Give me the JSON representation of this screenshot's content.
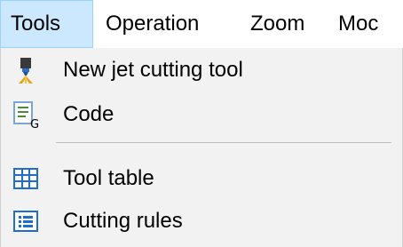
{
  "menubar": {
    "items": [
      {
        "label": "Tools",
        "active": true
      },
      {
        "label": "Operation",
        "active": false
      },
      {
        "label": "Zoom",
        "active": false
      },
      {
        "label": "Moc",
        "active": false
      }
    ]
  },
  "dropdown": {
    "items": [
      {
        "label": "New jet cutting tool",
        "icon": "jet-cutting-tool-icon"
      },
      {
        "label": "Code",
        "icon": "code-icon"
      },
      {
        "label": "Tool table",
        "icon": "table-icon"
      },
      {
        "label": "Cutting rules",
        "icon": "cutting-rules-icon"
      }
    ]
  },
  "colors": {
    "active_menu_bg": "#cce8ff",
    "active_menu_border": "#99d1ff",
    "dropdown_bg": "#f2f2f2",
    "icon_blue": "#1f6fc4"
  }
}
